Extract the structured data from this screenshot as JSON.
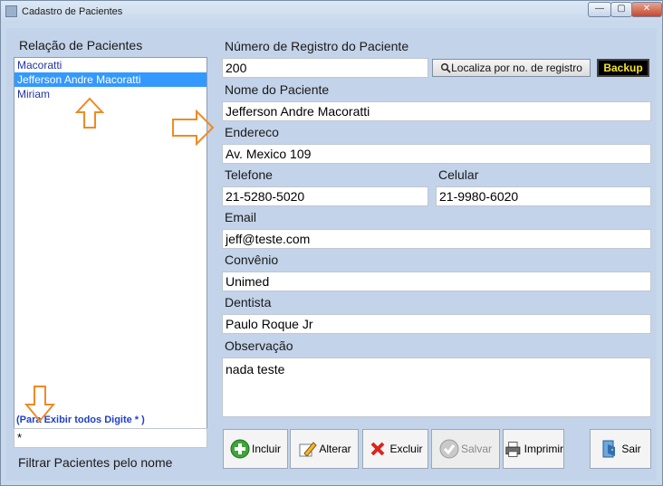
{
  "window": {
    "title": "Cadastro de Pacientes",
    "minimize": "—",
    "maximize": "▢",
    "close": "✕"
  },
  "list": {
    "label": "Relação de Pacientes",
    "items": [
      "Macoratti",
      "Jefferson Andre Macoratti",
      "Miriam"
    ],
    "selected_index": 1,
    "hint": "(Para Exibir todos Digite * )",
    "filter_value": "*",
    "filter_label": "Filtrar Pacientes pelo nome"
  },
  "form": {
    "registro_label": "Número de Registro do Paciente",
    "registro_value": "200",
    "localiza_label": "Localiza por no. de registro",
    "backup_label": "Backup",
    "nome_label": "Nome do Paciente",
    "nome_value": "Jefferson Andre Macoratti",
    "endereco_label": "Endereco",
    "endereco_value": "Av. Mexico 109",
    "telefone_label": "Telefone",
    "telefone_value": "21-5280-5020",
    "celular_label": "Celular",
    "celular_value": "21-9980-6020",
    "email_label": "Email",
    "email_value": "jeff@teste.com",
    "convenio_label": "Convênio",
    "convenio_value": "Unimed",
    "dentista_label": "Dentista",
    "dentista_value": "Paulo Roque Jr",
    "observacao_label": "Observação",
    "observacao_value": "nada teste"
  },
  "buttons": {
    "incluir": "Incluir",
    "alterar": "Alterar",
    "excluir": "Excluir",
    "salvar": "Salvar",
    "imprimir": "Imprimir",
    "sair": "Sair"
  },
  "icons": {
    "incluir": "plus-circle-icon",
    "alterar": "edit-pencil-icon",
    "excluir": "delete-x-icon",
    "salvar": "check-icon",
    "imprimir": "printer-icon",
    "sair": "exit-door-icon",
    "localiza": "search-icon"
  },
  "colors": {
    "window_bg": "#c3d3e9",
    "selection": "#3399ff",
    "annotation_arrow": "#f08a24",
    "hint_text": "#1e3fc8",
    "backup_text": "#f4e42a"
  }
}
